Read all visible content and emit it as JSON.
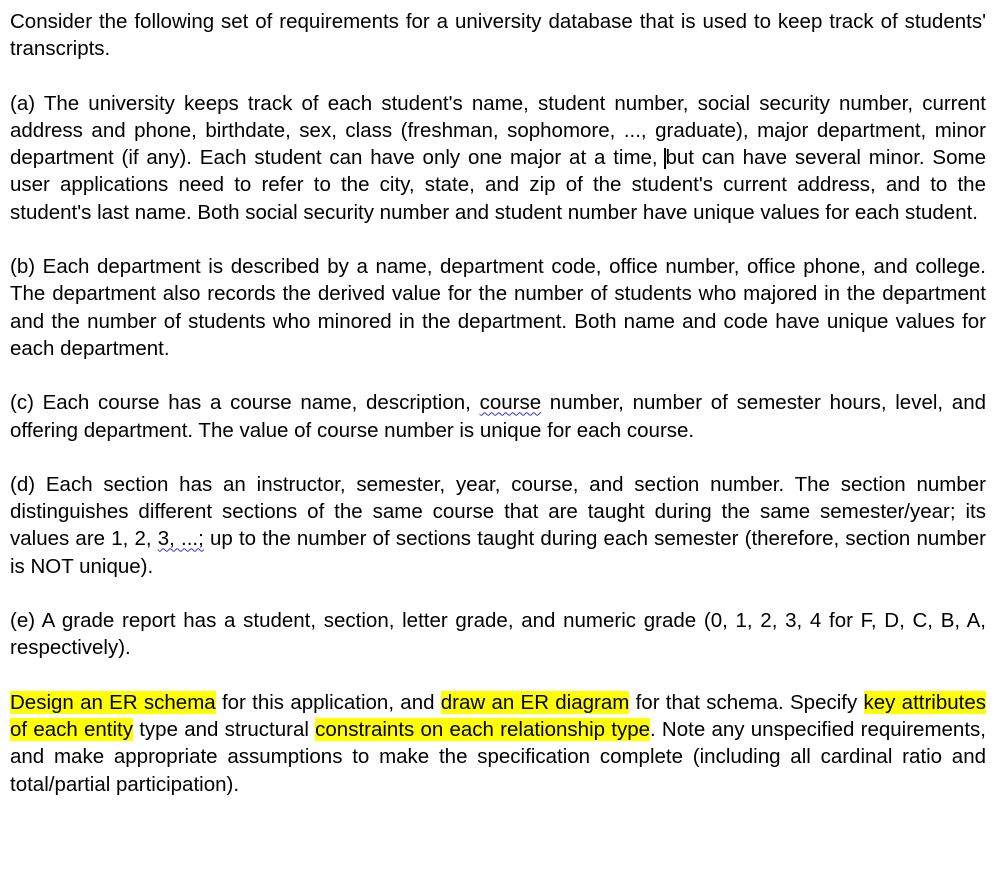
{
  "document": {
    "type": "text-document",
    "page_background": "#ffffff",
    "text_color": "#000000",
    "highlight_color": "#ffff00",
    "squiggle_color": "#3333cc",
    "alignment": "justified",
    "intro": {
      "text": "Consider the following set of requirements for a university database that is used to keep track of students' transcripts."
    },
    "requirements": [
      {
        "label": "(a)",
        "id": "requirement-a",
        "segment_1": "(a) The university keeps track of each student's name, student number, social security number, current address and phone, birthdate, sex, class (freshman, sophomore, ..., graduate), major department, minor department (if any). Each student can have only one major at a time, ",
        "caret": true,
        "segment_2": "but can have several minor.  Some user applications need to refer to the city, state, and zip of the student's current address, and to the student's last name. Both social security number and student number have unique values for each student."
      },
      {
        "label": "(b)",
        "id": "requirement-b",
        "text": "(b) Each department is described by a name, department code, office number, office phone, and college. The department also records the derived value for the number of students who majored in the department and the number of students who minored in the department. Both name and code have unique values for each department."
      },
      {
        "label": "(c)",
        "id": "requirement-c",
        "segment_1": "(c) Each course has a course name, description, ",
        "squiggle_word": "course",
        "segment_2": " number, number of semester hours, level, and offering department. The value of course number is unique for each course."
      },
      {
        "label": "(d)",
        "id": "requirement-d",
        "segment_1": "(d) Each section has an instructor, semester, year, course, and section number. The section number distinguishes different sections of the same course that are taught during the same semester/year; its values are 1, 2, ",
        "squiggle_word": "3, ...;",
        "segment_2": " up to the number of sections taught during each semester (therefore, section number is NOT unique)."
      },
      {
        "label": "(e)",
        "id": "requirement-e",
        "text": "(e) A grade report has a student, section, letter grade, and numeric grade (0, 1, 2, 3, 4 for F, D, C, B, A, respectively)."
      }
    ],
    "task": {
      "id": "task-paragraph",
      "highlight_1": "Design an ER schema",
      "plain_1": " for this application, and ",
      "highlight_2": "draw an ER diagram",
      "plain_2": " for that schema. Specify ",
      "highlight_3": "key attributes of each entity",
      "plain_3": " type and structural ",
      "highlight_4": "constraints on each relationship type",
      "plain_4": ". Note any unspecified requirements, and make appropriate assumptions to make the specification complete (including all cardinal ratio and total/partial participation)."
    }
  }
}
